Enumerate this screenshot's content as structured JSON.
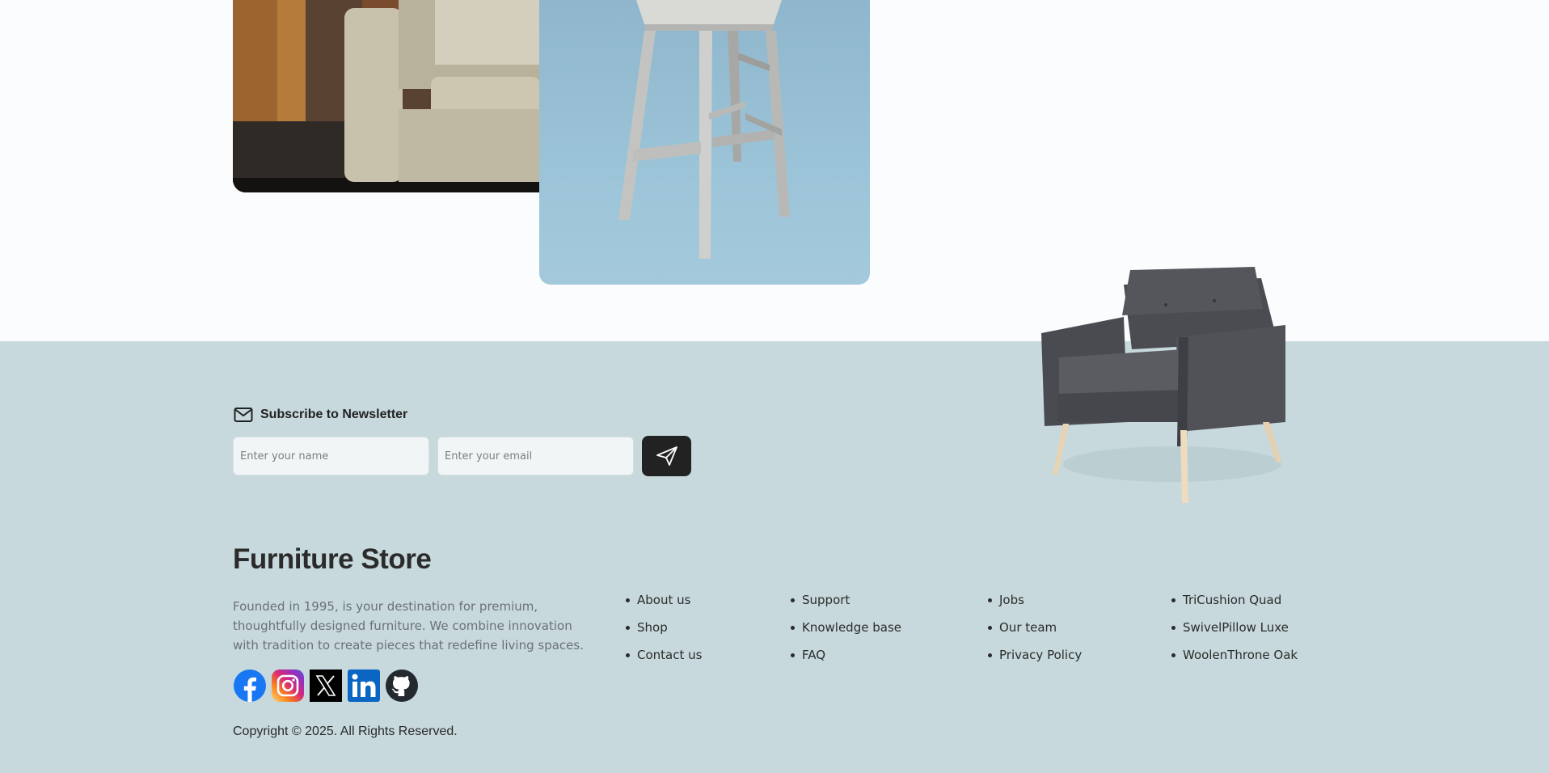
{
  "newsletter": {
    "title": "Subscribe to Newsletter",
    "name_placeholder": "Enter your name",
    "email_placeholder": "Enter your email",
    "name_value": "",
    "email_value": "",
    "icon": "mail-icon",
    "send_icon": "send-icon"
  },
  "brand": {
    "name": "Furniture Store",
    "description": "Founded in 1995, is your destination for premium, thoughtfully designed furniture. We combine innovation with tradition to create pieces that redefine living spaces."
  },
  "socials": [
    {
      "name": "Facebook",
      "icon": "facebook-icon",
      "color": "#1877f2"
    },
    {
      "name": "Instagram",
      "icon": "instagram-icon",
      "color": "#e1306c"
    },
    {
      "name": "X",
      "icon": "x-icon",
      "color": "#000000"
    },
    {
      "name": "LinkedIn",
      "icon": "linkedin-icon",
      "color": "#0a66c2"
    },
    {
      "name": "GitHub",
      "icon": "github-icon",
      "color": "#24292f"
    }
  ],
  "links": {
    "col1": [
      "About us",
      "Shop",
      "Contact us"
    ],
    "col2": [
      "Support",
      "Knowledge base",
      "FAQ"
    ],
    "col3": [
      "Jobs",
      "Our team",
      "Privacy Policy"
    ],
    "col4": [
      "TriCushion Quad",
      "SwivelPillow Luxe",
      "WoolenThrone Oak"
    ]
  },
  "copyright": "Copyright © 2025. All Rights Reserved.",
  "colors": {
    "footer_bg": "#c7d9dd",
    "page_bg": "#fbfcfd",
    "button_bg": "#222222"
  }
}
